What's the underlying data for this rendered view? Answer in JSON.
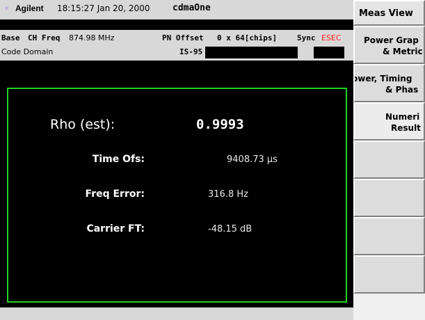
{
  "header": {
    "logo_icon": "starburst-icon",
    "brand": "Agilent",
    "time": "18:15:27  Jan 20, 2000",
    "mode": "cdmaOne"
  },
  "info": {
    "base": "Base",
    "ch_freq_label": "CH Freq",
    "ch_freq_value": "874.98 MHz",
    "pn_offset_label": "PN Offset",
    "pn_offset_value": "0 x 64[chips]",
    "sync_label": "Sync",
    "sync_value": "ESEC",
    "code_domain": "Code Domain",
    "standard": "IS-95"
  },
  "measurement": {
    "rho_label": "Rho (est):",
    "rho_value": "0.9993",
    "time_ofs_label": "Time Ofs:",
    "time_ofs_value": "9408.73 µs",
    "freq_error_label": "Freq Error:",
    "freq_error_value": "316.8  Hz",
    "carrier_ft_label": "Carrier FT:",
    "carrier_ft_value": "-48.15 dB"
  },
  "softkeys": {
    "title": "Meas View",
    "power_graph_1": "Power Grap",
    "power_graph_2": "& Metric",
    "power_timing_1": "ower, Timing",
    "power_timing_2": "& Phas",
    "numeric_1": "Numeri",
    "numeric_2": "Result"
  },
  "colors": {
    "border_green": "#22d322",
    "sync_red": "#ff2020",
    "panel_gray": "#d8d8d8"
  }
}
